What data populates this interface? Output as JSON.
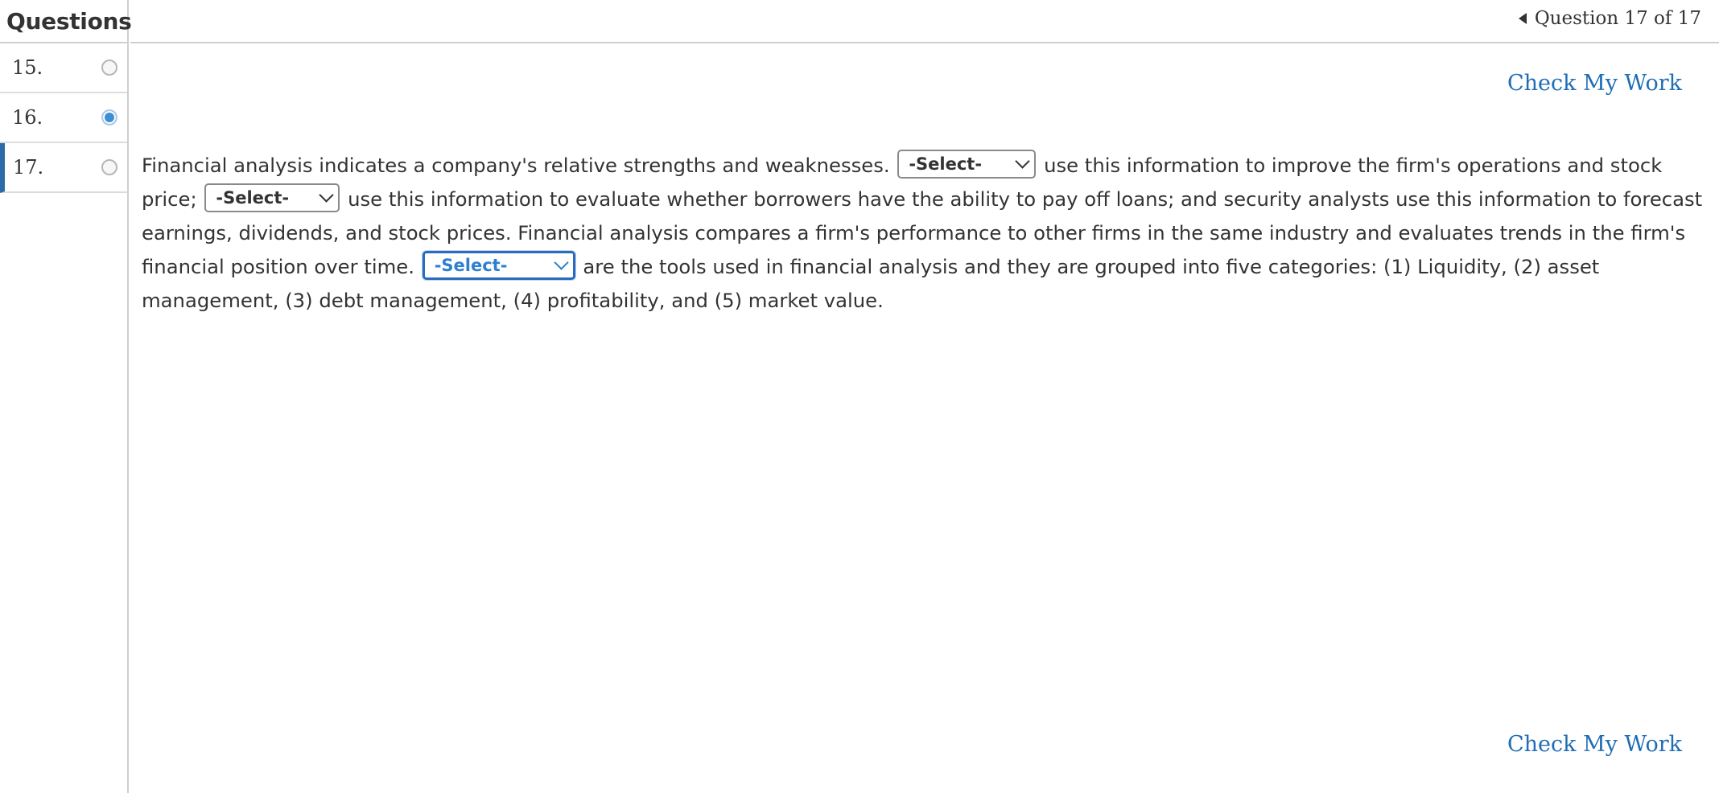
{
  "sidebar": {
    "title": "Questions",
    "items": [
      {
        "number": "15.",
        "answered": false
      },
      {
        "number": "16.",
        "answered": true
      },
      {
        "number": "17.",
        "answered": false
      }
    ]
  },
  "nav": {
    "label": "Question 17 of 17"
  },
  "actions": {
    "check_top": "Check My Work",
    "check_bottom": "Check My Work"
  },
  "question": {
    "text_1": "Financial analysis indicates a company's relative strengths and weaknesses.",
    "text_2": "use this information to improve the firm's operations and stock price;",
    "text_3": "use this information to evaluate whether borrowers have the ability to pay off loans; and security analysts use this information to forecast earnings, dividends, and stock prices. Financial analysis compares a firm's performance to other firms in the same industry and evaluates trends in the firm's financial position over time.",
    "text_4": "are the tools used in financial analysis and they are grouped into five categories: (1) Liquidity, (2) asset management, (3) debt management, (4) profitability, and (5) market value.",
    "select_1": "-Select-",
    "select_2": "-Select-",
    "select_3": "-Select-"
  },
  "colors": {
    "accent": "#1f6db5",
    "current_marker": "#2c6aa8",
    "answered_radio": "#3d8fd1"
  }
}
